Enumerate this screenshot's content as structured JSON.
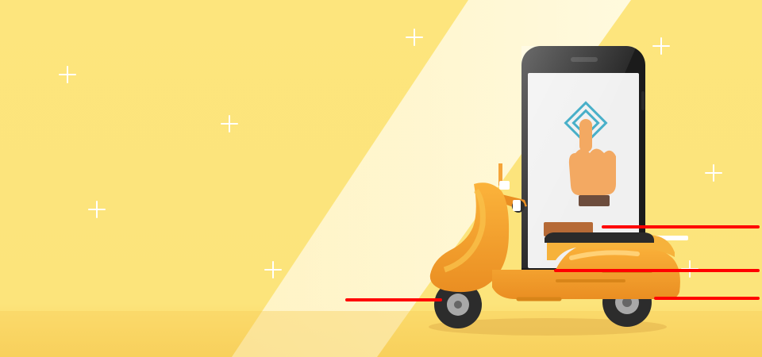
{
  "scene": {
    "title": "",
    "icons": [
      "sparkle-icon",
      "smartphone-icon",
      "touch-hand-icon",
      "scooter-icon",
      "speed-line-icon"
    ]
  },
  "colors": {
    "background": "#fde47a",
    "background_light": "#fff8d8",
    "ground": "#f7cf5a",
    "scooter_body": "#f2a02b",
    "scooter_highlight": "#f9c04a",
    "scooter_shadow": "#d88519",
    "phone_body": "#1a1a1a",
    "phone_screen": "#f0f0f0",
    "speed_lines": "#ff0000",
    "delivery_box": "#b66a36",
    "sparkle": "#ffffff",
    "touch_icon": "#49b0c9",
    "hand_skin": "#f3a962",
    "hand_cuff": "#6d4d3d"
  }
}
